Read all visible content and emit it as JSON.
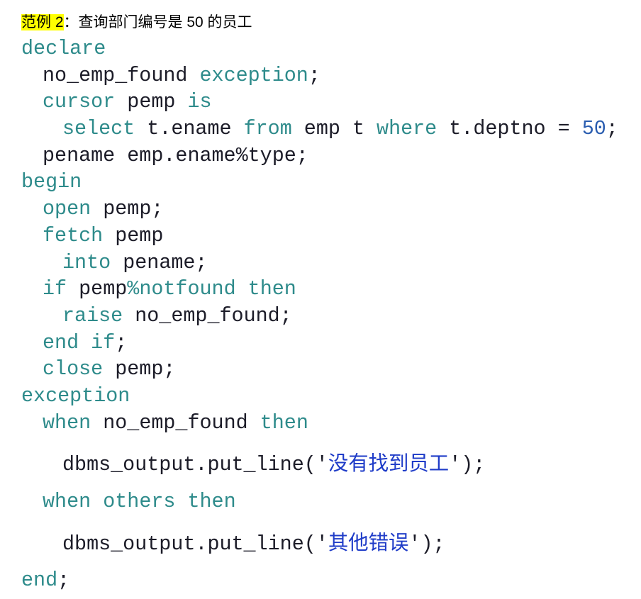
{
  "heading": {
    "label": "范例 2",
    "colon": "：",
    "title": "查询部门编号是 50 的员工"
  },
  "colors": {
    "keyword": "#2e8b8b",
    "identifier": "#1c1c28",
    "number": "#2a5db0",
    "string": "#1f3cc8",
    "highlight": "#ffff00"
  },
  "code": {
    "lines": [
      [
        "declare"
      ],
      [
        "no_emp_found",
        "exception",
        ";"
      ],
      [
        "cursor",
        "pemp",
        "is"
      ],
      [
        "select",
        "t.ename",
        "from",
        "emp t",
        "where",
        "t.deptno =",
        "50",
        ";"
      ],
      [
        "pename emp.ename%type;"
      ],
      [
        "begin"
      ],
      [
        "open",
        "pemp;"
      ],
      [
        "fetch",
        "pemp"
      ],
      [
        "into",
        "pename;"
      ],
      [
        "if",
        "pemp",
        "%notfound",
        "then"
      ],
      [
        "raise",
        "no_emp_found;"
      ],
      [
        "end",
        "if",
        ";"
      ],
      [
        "close",
        "pemp;"
      ],
      [
        "exception"
      ],
      [
        "when",
        "no_emp_found",
        "then"
      ],
      [
        "dbms_output.put_line('",
        "没有找到员工",
        "');"
      ],
      [
        "when",
        "others",
        "then"
      ],
      [
        "dbms_output.put_line('",
        "其他错误",
        "');"
      ],
      [
        "end",
        ";"
      ]
    ]
  }
}
